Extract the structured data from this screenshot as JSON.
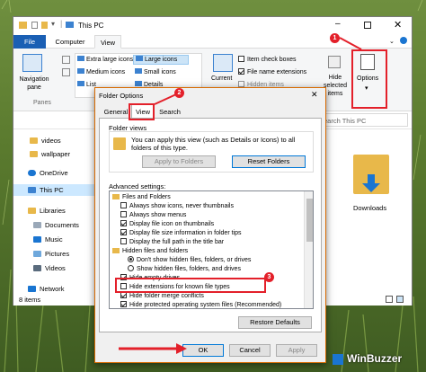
{
  "explorer": {
    "title": "This PC",
    "tabs": [
      "File",
      "Computer",
      "View"
    ],
    "ribbon": {
      "nav_pane": "Navigation pane",
      "panes": "Panes",
      "layout": [
        "Extra large icons",
        "Large icons",
        "Medium icons",
        "Small icons",
        "List",
        "Details"
      ],
      "current_view": "Current",
      "show_hide": [
        "Item check boxes",
        "File name extensions",
        "Hidden items"
      ],
      "hide_selected": "Hide selected items",
      "options": "Options"
    },
    "search_placeholder": "Search This PC",
    "nav_items": [
      "videos",
      "wallpaper",
      "OneDrive",
      "This PC",
      "Libraries",
      "Documents",
      "Music",
      "Pictures",
      "Videos",
      "Network"
    ],
    "downloads": "Downloads",
    "status": "8 items"
  },
  "dialog": {
    "title": "Folder Options",
    "close": "✕",
    "tabs": [
      "General",
      "View",
      "Search"
    ],
    "folder_views_label": "Folder views",
    "folder_views_text": "You can apply this view (such as Details or Icons) to all folders of this type.",
    "apply_to_folders": "Apply to Folders",
    "reset_folders": "Reset Folders",
    "advanced_label": "Advanced settings:",
    "tree": [
      {
        "kind": "folder",
        "text": "Files and Folders"
      },
      {
        "kind": "cb",
        "checked": false,
        "text": "Always show icons, never thumbnails"
      },
      {
        "kind": "cb",
        "checked": false,
        "text": "Always show menus"
      },
      {
        "kind": "cb",
        "checked": true,
        "text": "Display file icon on thumbnails"
      },
      {
        "kind": "cb",
        "checked": true,
        "text": "Display file size information in folder tips"
      },
      {
        "kind": "cb",
        "checked": false,
        "text": "Display the full path in the title bar"
      },
      {
        "kind": "folder",
        "text": "Hidden files and folders"
      },
      {
        "kind": "rb",
        "checked": true,
        "text": "Don't show hidden files, folders, or drives"
      },
      {
        "kind": "rb",
        "checked": false,
        "text": "Show hidden files, folders, and drives"
      },
      {
        "kind": "cb",
        "checked": true,
        "text": "Hide empty drives"
      },
      {
        "kind": "cb",
        "checked": false,
        "text": "Hide extensions for known file types"
      },
      {
        "kind": "cb",
        "checked": true,
        "text": "Hide folder merge conflicts"
      },
      {
        "kind": "cb",
        "checked": true,
        "text": "Hide protected operating system files (Recommended)"
      }
    ],
    "restore_defaults": "Restore Defaults",
    "ok": "OK",
    "cancel": "Cancel",
    "apply": "Apply"
  },
  "annotations": [
    "1",
    "2",
    "3"
  ],
  "watermark": "WinBuzzer",
  "colors": {
    "accent": "#0078d7",
    "annotation": "#e3202a",
    "dialog_border": "#d86a00",
    "folder": "#e8b84a"
  }
}
